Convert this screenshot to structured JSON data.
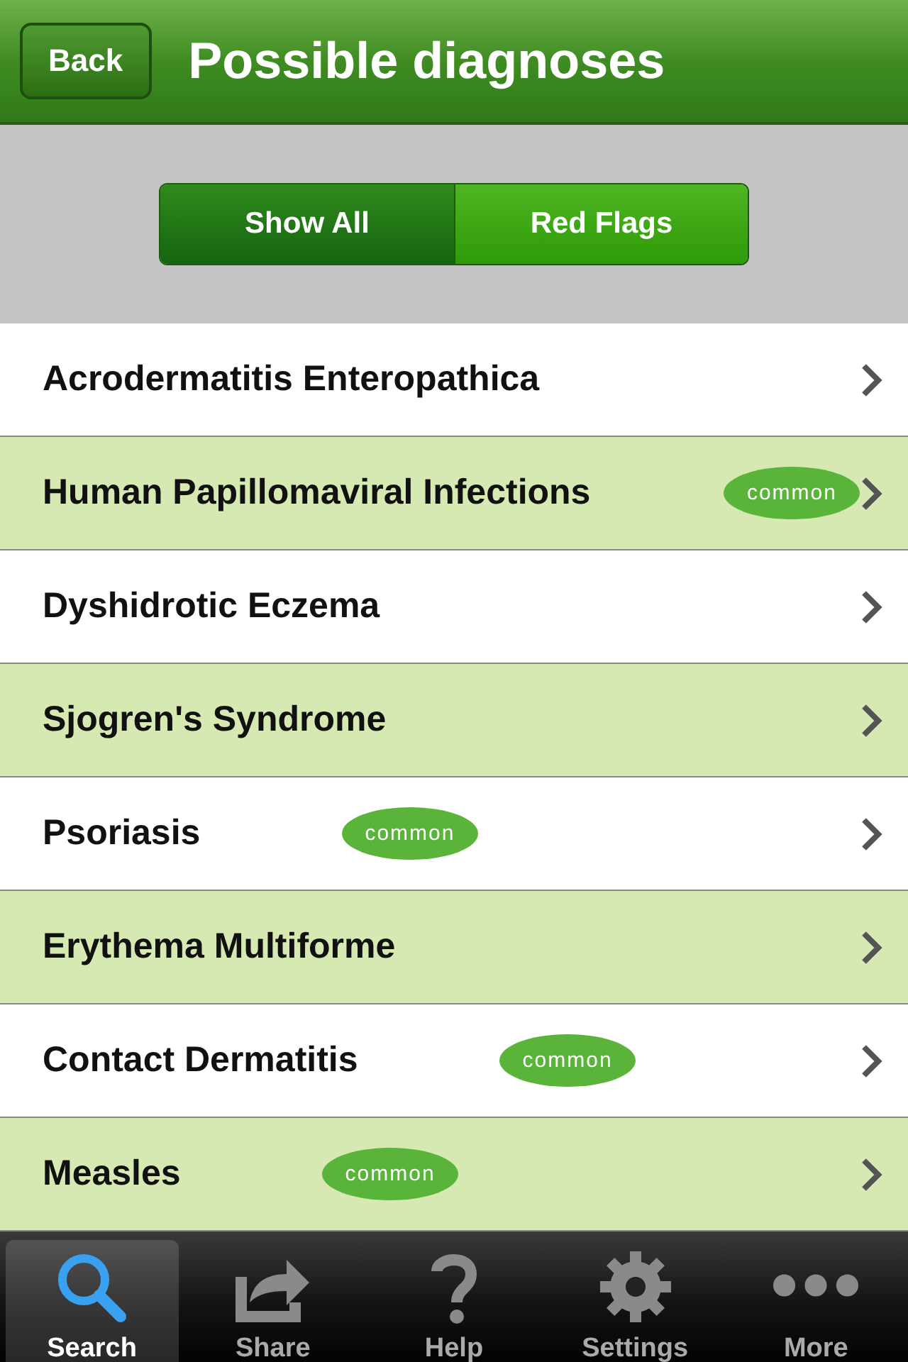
{
  "nav_bar": {
    "back_button": "Back",
    "title": "Possible diagnoses"
  },
  "segments": [
    {
      "label": "Show All",
      "selected": true
    },
    {
      "label": "Red Flags",
      "selected": false
    }
  ],
  "diagnoses": [
    {
      "name": "Acrodermatitis Enteropathica"
    },
    {
      "name": "Human Papillomaviral Infections",
      "badge": "common"
    },
    {
      "name": "Dyshidrotic Eczema"
    },
    {
      "name": "Sjogren's Syndrome"
    },
    {
      "name": "Psoriasis",
      "badge": "common"
    },
    {
      "name": "Erythema Multiforme"
    },
    {
      "name": "Contact Dermatitis",
      "badge": "common"
    },
    {
      "name": "Measles",
      "badge": "common"
    }
  ],
  "tab_bar": [
    {
      "kind": "search",
      "label": "Search",
      "selected": true
    },
    {
      "kind": "share",
      "label": "Share",
      "selected": false
    },
    {
      "kind": "help",
      "label": "Help",
      "selected": false
    },
    {
      "kind": "settings",
      "label": "Settings",
      "selected": false
    },
    {
      "kind": "more",
      "label": "More",
      "selected": false
    }
  ]
}
